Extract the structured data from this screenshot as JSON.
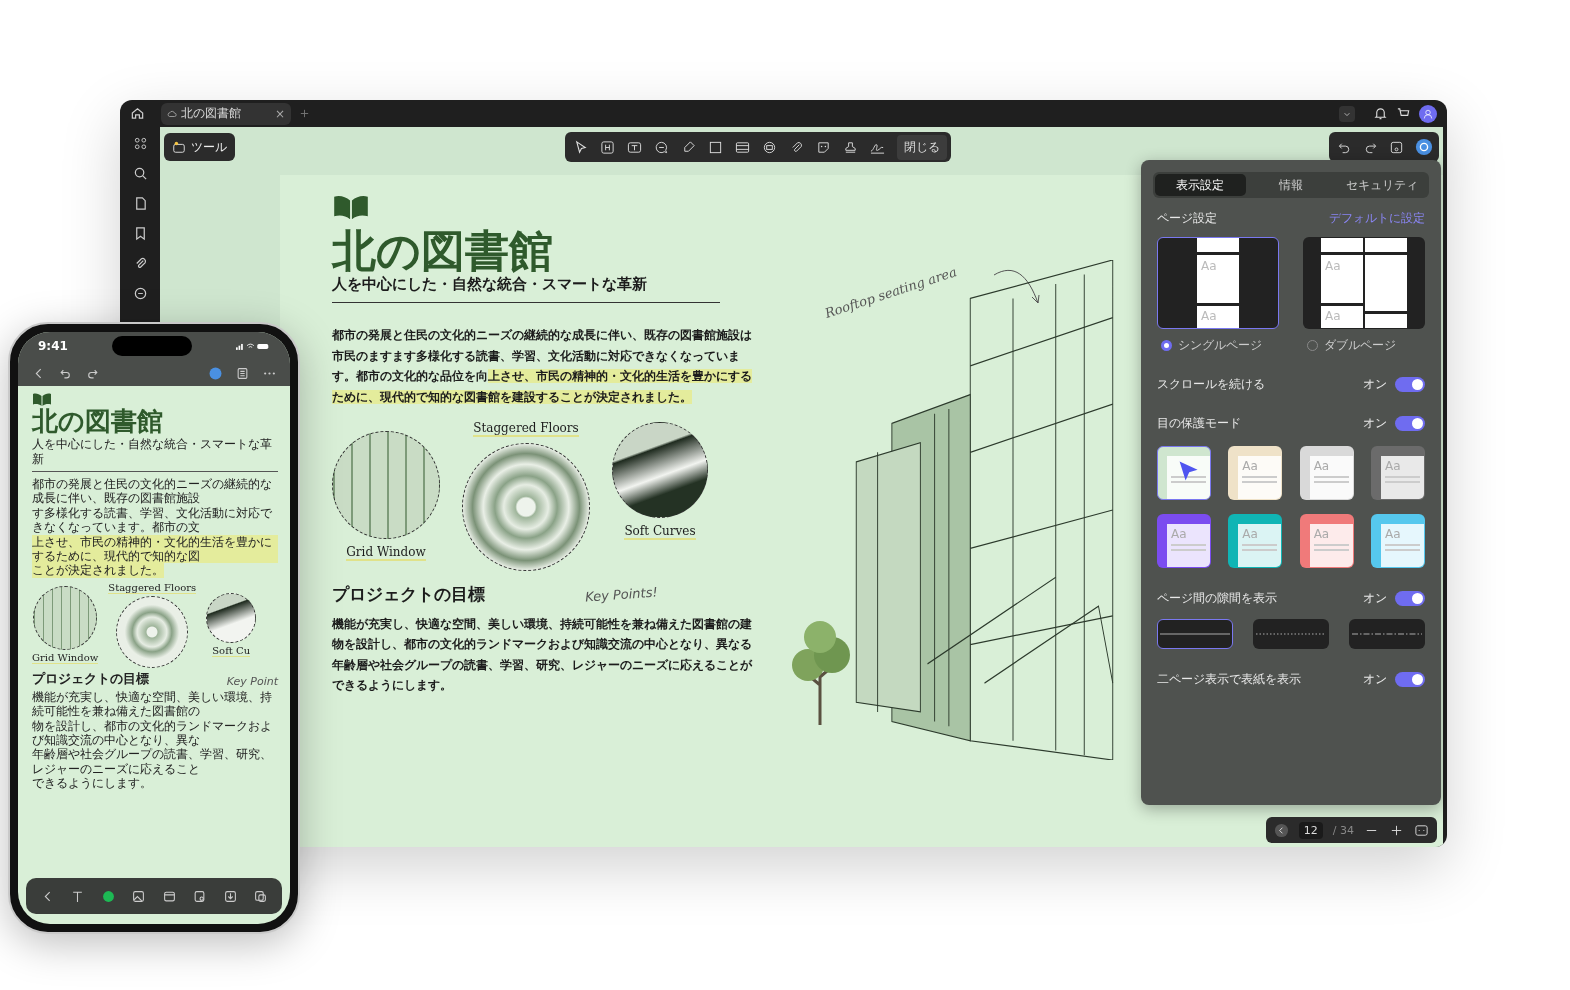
{
  "window": {
    "tab": {
      "title": "北の図書館",
      "close": "×"
    }
  },
  "tools_button": "ツール",
  "close_button": "閉じる",
  "document": {
    "title": "北の図書館",
    "subtitle": "人を中心にした・自然な統合・スマートな革新",
    "paragraph": {
      "text": "都市の発展と住民の文化的ニーズの継続的な成長に伴い、既存の図書館施設は市民のますます多様化する読書、学習、文化活動に対応できなくなっています。都市の文化的な品位を向",
      "highlight": "上させ、市民の精神的・文化的生活を豊かにするために、現代的で知的な図書館を建設することが決定されました。"
    },
    "photos": [
      {
        "label": "Grid Window"
      },
      {
        "label": "Staggered Floors"
      },
      {
        "label": "Soft Curves"
      }
    ],
    "section_heading": "プロジェクトの目標",
    "handwritten_note": "Key Points!",
    "section_text": "機能が充実し、快適な空間、美しい環境、持続可能性を兼ね備えた図書館の建物を設計し、都市の文化的ランドマークおよび知識交流の中心となり、異なる年齢層や社会グループの読書、学習、研究、レジャーのニーズに応えることができるようにします。",
    "sketch_note": "Rooftop seating area"
  },
  "settings_panel": {
    "tabs": [
      {
        "label": "表示設定",
        "selected": true
      },
      {
        "label": "情報",
        "selected": false
      },
      {
        "label": "セキュリティ",
        "selected": false
      }
    ],
    "page_settings": {
      "label": "ページ設定",
      "link": "デフォルトに設定",
      "layouts": [
        {
          "label": "シングルページ",
          "kind": "single",
          "samples": [
            "Aa",
            "Aa"
          ],
          "selected": true
        },
        {
          "label": "ダブルページ",
          "kind": "double",
          "samples": [
            "Aa",
            "Aa"
          ],
          "selected": false
        }
      ]
    },
    "sections": [
      {
        "label": "スクロールを続ける",
        "state_label": "オン",
        "on": true
      },
      {
        "label": "目の保護モード",
        "state_label": "オン",
        "on": true,
        "themes": [
          {
            "color": "#cfe6cf",
            "selected": true
          },
          {
            "sample": "Aa",
            "color": "#efe2c8",
            "selected": false
          },
          {
            "sample": "Aa",
            "color": "#d9d9d9",
            "selected": false
          },
          {
            "sample": "Aa",
            "color": "#6b6b6b",
            "selected": false
          },
          {
            "sample": "Aa",
            "color": "#7b4cf0",
            "selected": false
          },
          {
            "sample": "Aa",
            "color": "#10b5b5",
            "selected": false
          },
          {
            "sample": "Aa",
            "color": "#f07a7a",
            "selected": false
          },
          {
            "sample": "Aa",
            "color": "#56c8ee",
            "selected": false
          }
        ]
      },
      {
        "label": "ページ間の隙間を表示",
        "state_label": "オン",
        "on": true,
        "separators": [
          {
            "kind": "solid",
            "selected": true
          },
          {
            "kind": "dotted",
            "selected": false
          },
          {
            "kind": "dashdot",
            "selected": false
          }
        ]
      },
      {
        "label": "二ページ表示で表紙を表示",
        "state_label": "オン",
        "on": true
      }
    ]
  },
  "page_nav": {
    "page": "12",
    "total": "/ 34"
  },
  "phone": {
    "time": "9:41",
    "title": "北の図書館",
    "subtitle": "人を中心にした・自然な統合・スマートな革新",
    "paragraph_lines": [
      {
        "text": "都市の発展と住民の文化的ニーズの継続的な成長に伴い、既存の図書館施設",
        "highlighted": false
      },
      {
        "text": "す多様化する読書、学習、文化活動に対応できなくなっています。都市の文",
        "highlighted": false
      },
      {
        "text": "上させ、市民の精神的・文化的生活を豊かにするために、現代的で知的な図",
        "highlighted": true
      },
      {
        "text": "ことが決定されました。",
        "highlighted": true
      }
    ],
    "photo_labels": [
      "Grid Window",
      "Staggered Floors",
      "Soft Cu"
    ],
    "section_heading": "プロジェクトの目標",
    "handwritten_note": "Key Point",
    "section_lines": [
      "機能が充実し、快適な空間、美しい環境、持続可能性を兼ね備えた図書館の",
      "物を設計し、都市の文化的ランドマークおよび知識交流の中心となり、異な",
      "年齢層や社会グループの読書、学習、研究、レジャーのニーズに応えること",
      "できるようにします。"
    ]
  }
}
